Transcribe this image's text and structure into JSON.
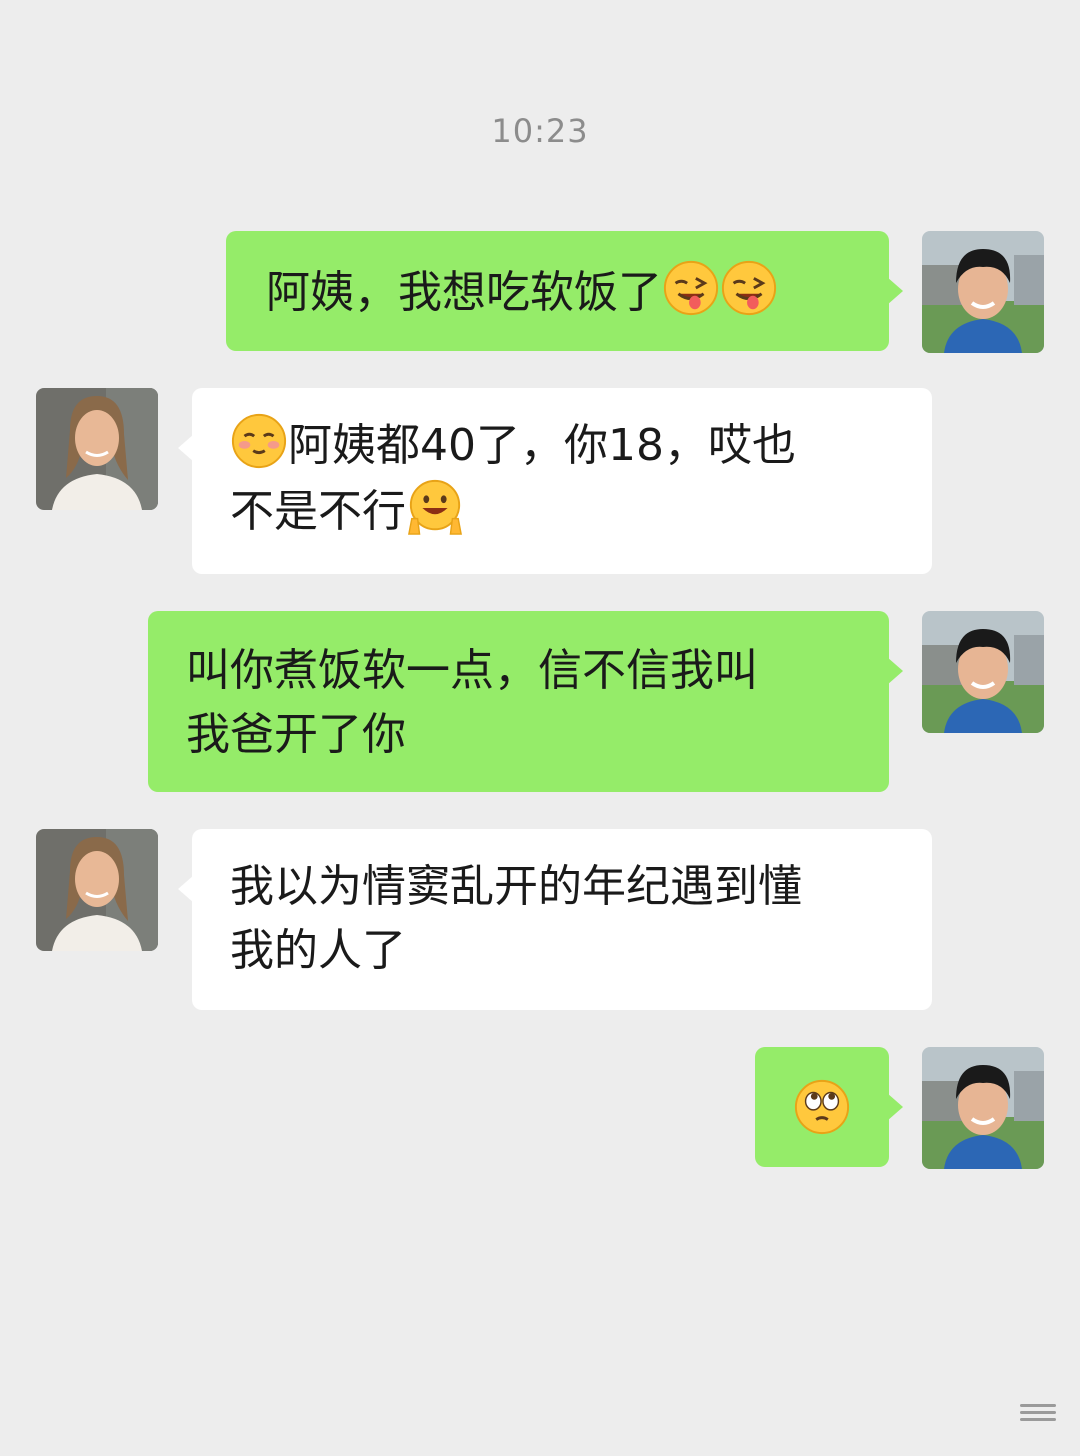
{
  "chat": {
    "timestamp": "10:23",
    "messages": [
      {
        "side": "sent",
        "sender": "boy",
        "text": "阿姨，我想吃软饭了",
        "emojis": [
          "wink-tongue-emoji",
          "wink-tongue-emoji"
        ]
      },
      {
        "side": "received",
        "sender": "woman",
        "prefix_emoji": "blush-emoji",
        "line1": "阿姨都40了，你18，哎也",
        "line2": "不是不行",
        "emojis": [
          "peace-sign-grin-emoji"
        ]
      },
      {
        "side": "sent",
        "sender": "boy",
        "line1": "叫你煮饭软一点，信不信我叫",
        "line2": "我爸开了你"
      },
      {
        "side": "received",
        "sender": "woman",
        "line1": "我以为情窦乱开的年纪遇到懂",
        "line2": "我的人了"
      },
      {
        "side": "sent",
        "sender": "boy",
        "emojis": [
          "rolling-eyes-emoji"
        ]
      }
    ]
  },
  "colors": {
    "background": "#EDEDED",
    "sent_bubble": "#95EC69",
    "received_bubble": "#FFFFFF",
    "timestamp_text": "#8C8C8C"
  }
}
